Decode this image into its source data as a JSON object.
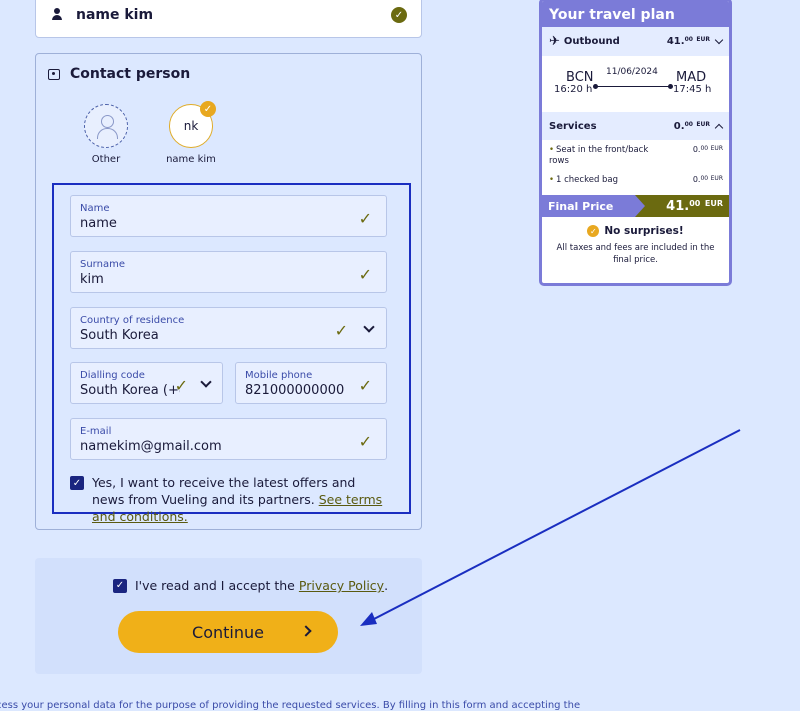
{
  "passenger": {
    "name": "name kim"
  },
  "contact": {
    "title": "Contact person",
    "avatars": [
      {
        "label": "Other"
      },
      {
        "initials": "nk",
        "label": "name kim"
      }
    ],
    "fields": {
      "name": {
        "label": "Name",
        "value": "name"
      },
      "surname": {
        "label": "Surname",
        "value": "kim"
      },
      "country": {
        "label": "Country of residence",
        "value": "South Korea"
      },
      "dialling": {
        "label": "Dialling code",
        "value": "South Korea (+82"
      },
      "mobile": {
        "label": "Mobile phone",
        "value": "821000000000"
      },
      "email": {
        "label": "E-mail",
        "value": "namekim@gmail.com"
      }
    },
    "offers": {
      "text": "Yes, I want to receive the latest offers and news from Vueling and its partners. ",
      "link": "See terms and conditions."
    }
  },
  "privacy": {
    "text": "I've read and I accept the",
    "link": "Privacy Policy",
    "suffix": "."
  },
  "continue_label": "Continue",
  "footer_text": "cess your personal data for the purpose of providing the requested services. By filling in this form and accepting the",
  "travel_plan": {
    "title": "Your travel plan",
    "outbound": {
      "label": "Outbound",
      "price_int": "41.",
      "price_dec": "00",
      "currency": "EUR"
    },
    "route": {
      "from": "BCN",
      "from_time": "16:20 h",
      "date": "11/06/2024",
      "to": "MAD",
      "to_time": "17:45 h"
    },
    "services": {
      "label": "Services",
      "price_int": "0.",
      "price_dec": "00",
      "currency": "EUR",
      "items": [
        {
          "name": "Seat in the front/back rows",
          "price_int": "0.",
          "price_dec": "00",
          "currency": "EUR"
        },
        {
          "name": "1 checked bag",
          "price_int": "0.",
          "price_dec": "00",
          "currency": "EUR"
        }
      ]
    },
    "final": {
      "label": "Final Price",
      "price_int": "41.",
      "price_dec": "00",
      "currency": "EUR"
    },
    "no_surprises": {
      "title": "No surprises!",
      "text": "All taxes and fees are included in the final price."
    }
  },
  "colors": {
    "accent": "#7b7bd8",
    "olive": "#6b6a10",
    "button": "#f0b018",
    "annotation": "#1a2ec0"
  }
}
